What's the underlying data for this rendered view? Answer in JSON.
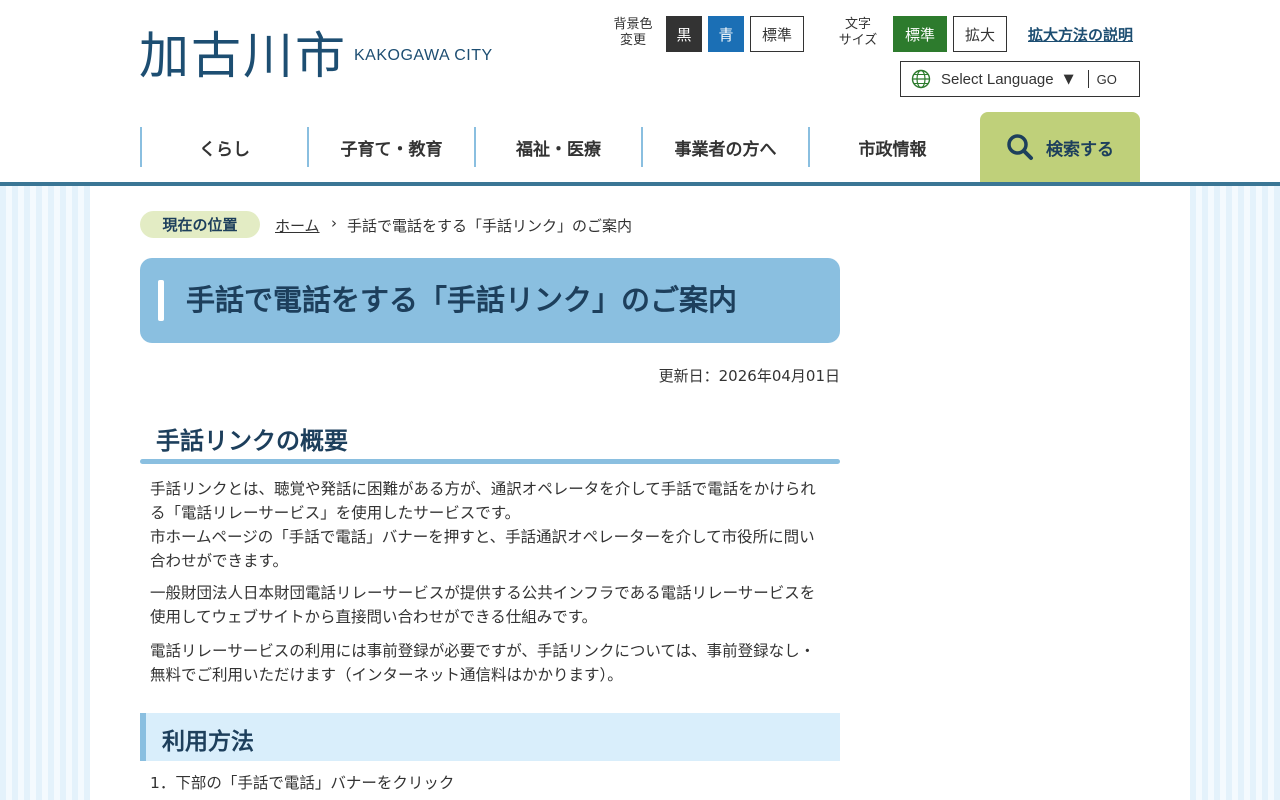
{
  "header": {
    "logo_kanji": "加古川市",
    "logo_en": "KAKOGAWA CITY",
    "bg_color_label": "背景色\n変更",
    "bg_buttons": {
      "black": "黒",
      "blue": "青",
      "standard": "標準"
    },
    "font_size_label": "文字\nサイズ",
    "size_buttons": {
      "standard": "標準",
      "large": "拡大"
    },
    "explain_link": "拡大方法の説明",
    "language": {
      "select_label": "Select Language",
      "arrow": "▼",
      "go": "GO"
    }
  },
  "nav": {
    "items": [
      {
        "label": "くらし"
      },
      {
        "label": "子育て・教育"
      },
      {
        "label": "福祉・医療"
      },
      {
        "label": "事業者の方へ"
      },
      {
        "label": "市政情報"
      }
    ],
    "search_label": "検索する"
  },
  "breadcrumb": {
    "label": "現在の位置",
    "home": "ホーム",
    "separator": "›",
    "current": "手話で電話をする「手話リンク」のご案内"
  },
  "page": {
    "title": "手話で電話をする「手話リンク」のご案内",
    "updated": "更新日：2026年04月01日",
    "section1_heading": "手話リンクの概要",
    "paragraphs": [
      "手話リンクとは、聴覚や発話に困難がある方が、通訳オペレータを介して手話で電話をかけられる「電話リレーサービス」を使用したサービスです。\n市ホームページの「手話で電話」バナーを押すと、手話通訳オペレーターを介して市役所に問い合わせができます。",
      "一般財団法人日本財団電話リレーサービスが提供する公共インフラである電話リレーサービスを使用してウェブサイトから直接問い合わせができる仕組みです。",
      "電話リレーサービスの利用には事前登録が必要ですが、手話リンクについては、事前登録なし・無料でご利用いただけます（インターネット通信料はかかります）。"
    ],
    "section2_heading": "利用方法",
    "step1": "1．下部の「手話で電話」バナーをクリック"
  },
  "colors": {
    "brand": "#1d4e72",
    "accent_blue": "#8abfe0",
    "search_green": "#bfd07a",
    "size_active": "#2d7b2d",
    "bg_blue_button": "#1b6fb5"
  }
}
